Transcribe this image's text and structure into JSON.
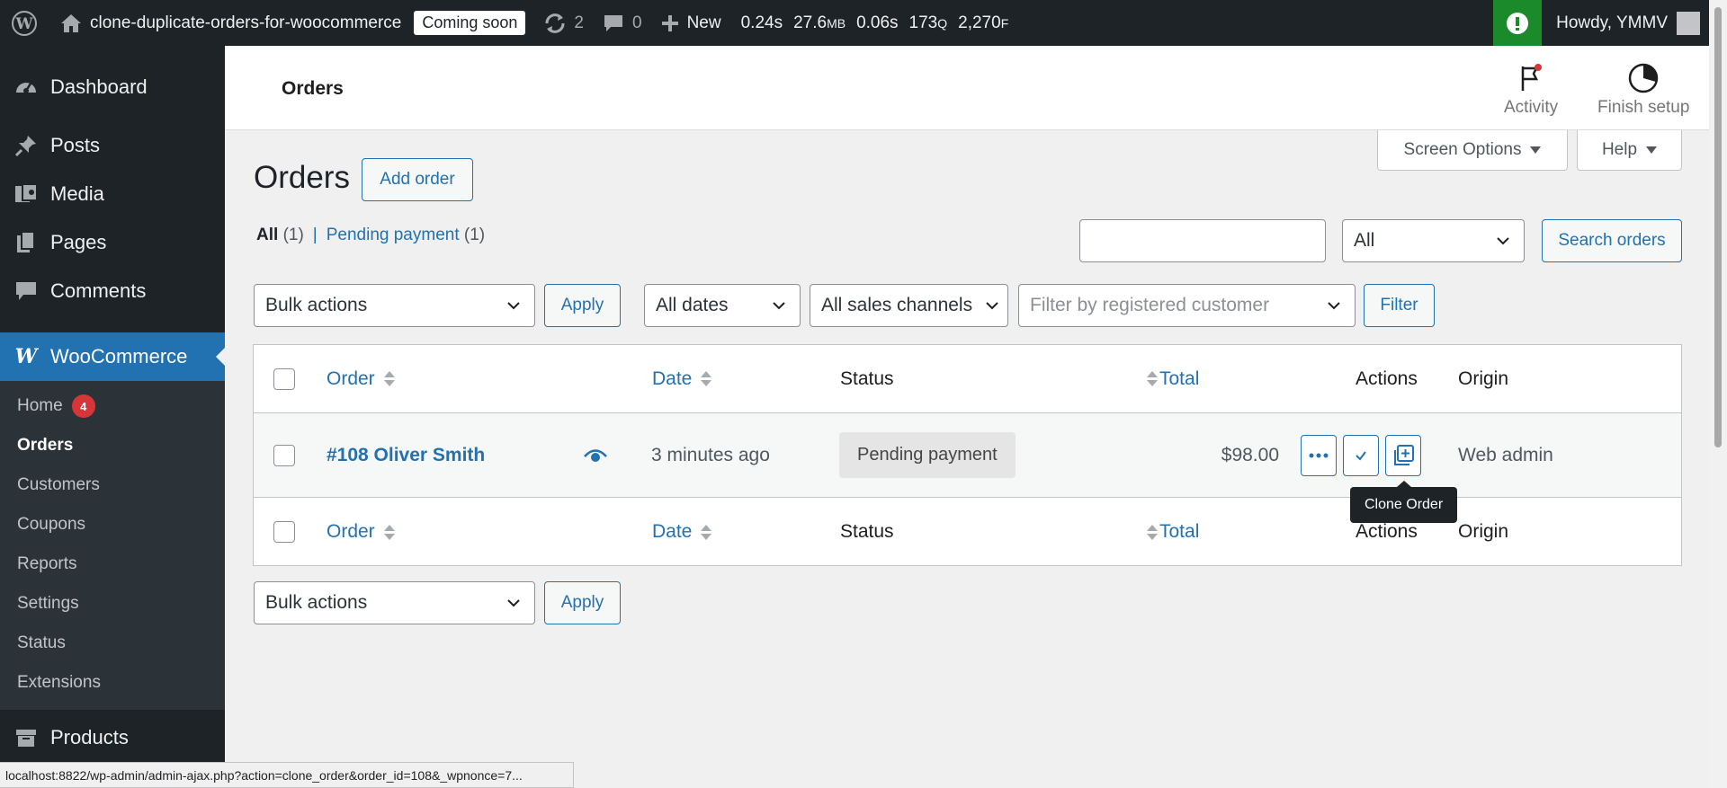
{
  "adminbar": {
    "site_name": "clone-duplicate-orders-for-woocommerce",
    "coming_soon": "Coming soon",
    "updates_count": "2",
    "comments_count": "0",
    "new_label": "New",
    "qm": {
      "time": "0.24s",
      "memory": "27.6",
      "memory_unit": "MB",
      "db_time": "0.06s",
      "queries": "173",
      "queries_unit": "Q",
      "files": "2,270",
      "files_unit": "F"
    },
    "howdy": "Howdy, YMMV"
  },
  "sidebar": {
    "dashboard": "Dashboard",
    "posts": "Posts",
    "media": "Media",
    "pages": "Pages",
    "comments": "Comments",
    "woocommerce": "WooCommerce",
    "submenu": {
      "home": "Home",
      "home_badge": "4",
      "orders": "Orders",
      "customers": "Customers",
      "coupons": "Coupons",
      "reports": "Reports",
      "settings": "Settings",
      "status": "Status",
      "extensions": "Extensions"
    },
    "products": "Products"
  },
  "header": {
    "title": "Orders",
    "activity": "Activity",
    "finish_setup": "Finish setup"
  },
  "screen_options": "Screen Options",
  "help": "Help",
  "page": {
    "heading": "Orders",
    "add_order": "Add order",
    "views": {
      "all_label": "All",
      "all_count": "(1)",
      "separator": "|",
      "pending_label": "Pending payment",
      "pending_count": "(1)"
    },
    "search": {
      "value": "",
      "status_select": "All",
      "button": "Search orders"
    },
    "filters": {
      "bulk_actions": "Bulk actions",
      "apply": "Apply",
      "dates": "All dates",
      "channels": "All sales channels",
      "customer_placeholder": "Filter by registered customer",
      "filter": "Filter"
    }
  },
  "table": {
    "columns": {
      "order": "Order",
      "date": "Date",
      "status": "Status",
      "total": "Total",
      "actions": "Actions",
      "origin": "Origin"
    },
    "rows": [
      {
        "order": "#108 Oliver Smith",
        "date": "3 minutes ago",
        "status": "Pending payment",
        "total": "$98.00",
        "origin": "Web admin"
      }
    ]
  },
  "tooltip": "Clone Order",
  "bottom": {
    "bulk_actions": "Bulk actions",
    "apply": "Apply"
  },
  "statusbar": "localhost:8822/wp-admin/admin-ajax.php?action=clone_order&order_id=108&_wpnonce=7..."
}
